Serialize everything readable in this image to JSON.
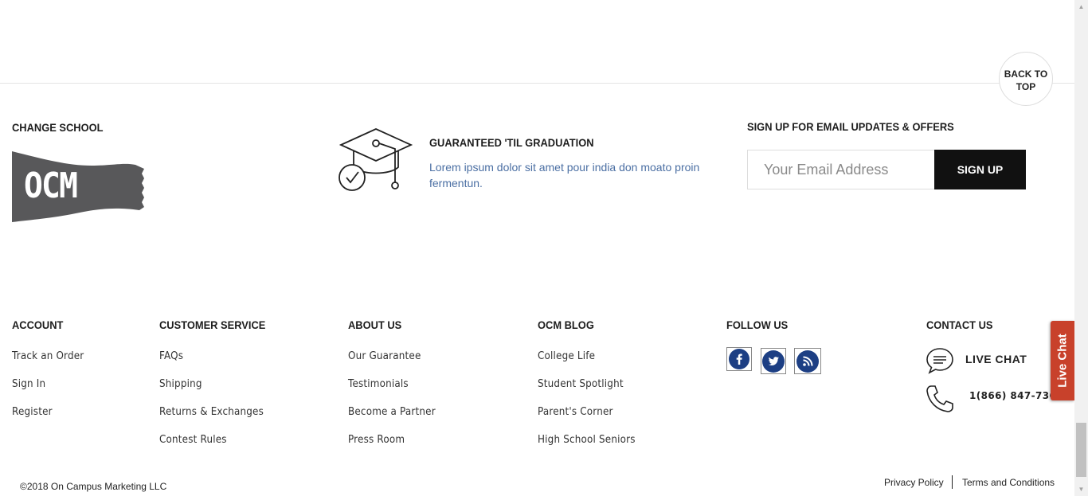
{
  "back_to_top": {
    "line1": "BACK TO",
    "line2": "TOP"
  },
  "change_school": {
    "heading": "CHANGE SCHOOL",
    "logo_text": "OCM",
    "logo_color": "#58585a"
  },
  "guarantee": {
    "heading": "GUARANTEED 'TIL GRADUATION",
    "text": "Lorem ipsum dolor sit amet pour india don moato proin fermentun.",
    "icon": "graduation-cap-check-icon"
  },
  "signup": {
    "heading": "SIGN UP FOR EMAIL UPDATES & OFFERS",
    "placeholder": "Your Email Address",
    "button": "SIGN UP"
  },
  "columns": {
    "account": {
      "heading": "ACCOUNT",
      "links": [
        "Track an Order",
        "Sign In",
        "Register"
      ]
    },
    "customer_service": {
      "heading": "CUSTOMER SERVICE",
      "links": [
        "FAQs",
        "Shipping",
        "Returns & Exchanges",
        "Contest Rules"
      ]
    },
    "about_us": {
      "heading": "ABOUT US",
      "links": [
        "Our Guarantee",
        "Testimonials",
        "Become a Partner",
        "Press Room"
      ]
    },
    "blog": {
      "heading": "OCM BLOG",
      "links": [
        "College Life",
        "Student Spotlight",
        "Parent's Corner",
        "High School Seniors"
      ]
    }
  },
  "follow": {
    "heading": "FOLLOW US",
    "icons": [
      "facebook-icon",
      "twitter-icon",
      "rss-icon"
    ],
    "icon_color": "#1d3f84"
  },
  "contact": {
    "heading": "CONTACT US",
    "live_chat": "LIVE CHAT",
    "phone": "1(866) 847-7365"
  },
  "live_chat_tab": {
    "label": "Live Chat",
    "color": "#c8412b"
  },
  "footer": {
    "copyright": "©2018 On Campus Marketing LLC",
    "privacy": "Privacy Policy",
    "terms": "Terms and Conditions"
  }
}
